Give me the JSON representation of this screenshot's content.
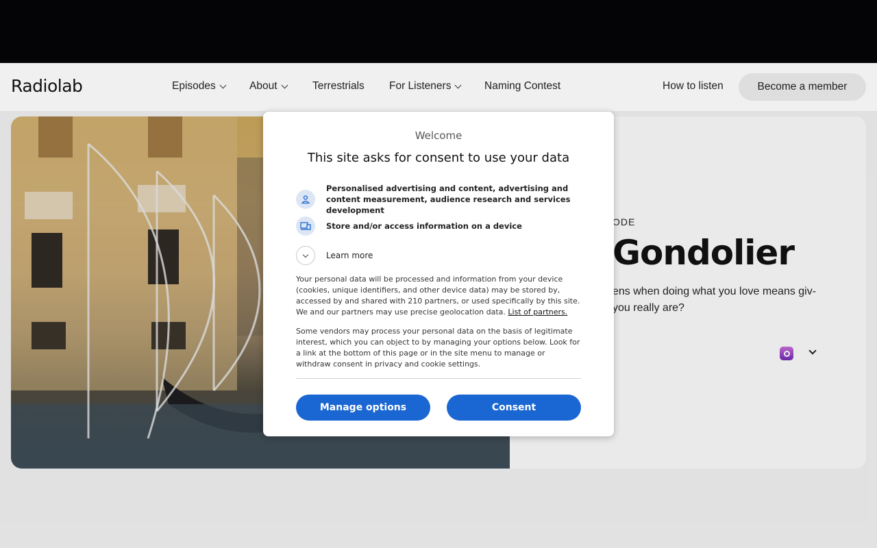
{
  "site": {
    "logo": "Radiolab",
    "nav": [
      {
        "label": "Episodes",
        "has_menu": true
      },
      {
        "label": "About",
        "has_menu": true
      },
      {
        "label": "Terrestrials",
        "has_menu": false
      },
      {
        "label": "For Listeners",
        "has_menu": true
      },
      {
        "label": "Naming Contest",
        "has_menu": false
      }
    ],
    "how_to_listen": "How to listen",
    "member_button": "Become a member"
  },
  "episode": {
    "kicker": "ODE",
    "title": "Gondolier",
    "description": "ens when doing what you love means giv- you really are?"
  },
  "consent": {
    "welcome": "Welcome",
    "title": "This site asks for consent to use your data",
    "purposes": [
      {
        "icon": "person-icon",
        "text": "Personalised advertising and content, advertising and content measurement, audience research and services development"
      },
      {
        "icon": "device-icon",
        "text": "Store and/or access information on a device"
      }
    ],
    "learn_more": "Learn more",
    "paragraph1": "Your personal data will be processed and information from your device (cookies, unique identifiers, and other device data) may be stored by, accessed by and shared with 210 partners, or used specifically by this site. We and our partners may use precise geolocation data.",
    "partners_link": "List of partners.",
    "paragraph2": "Some vendors may process your personal data on the basis of legitimate interest, which you can object to by managing your options below. Look for a link at the bottom of this page or in the site menu to manage or withdraw consent in privacy and cookie settings.",
    "manage_button": "Manage options",
    "consent_button": "Consent"
  },
  "colors": {
    "accent": "#1a66d2",
    "topbar": "#050507",
    "icon_bg": "#dde6f4"
  }
}
